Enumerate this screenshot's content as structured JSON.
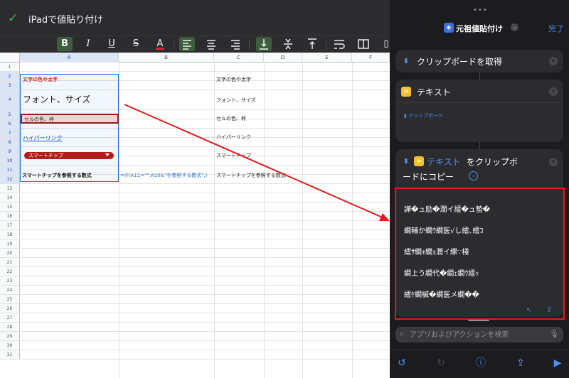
{
  "topbar": {
    "check_icon": "check-icon",
    "title": "iPadで値貼り付け"
  },
  "toolbar": {
    "bold": "B",
    "italic": "I",
    "underline": "U",
    "strike": "S",
    "textcolor": "A",
    "text_color_bar": "#d62b2b",
    "active_bg": "#3d5e3e"
  },
  "sheet": {
    "columns": [
      "A",
      "B",
      "C",
      "D",
      "E",
      "F"
    ],
    "rows": [
      "1",
      "2",
      "3",
      "4",
      "5",
      "6",
      "7",
      "8",
      "9",
      "10",
      "11",
      "12",
      "13",
      "14",
      "15",
      "16",
      "17",
      "18",
      "19",
      "20",
      "21",
      "22",
      "23",
      "24",
      "25",
      "26",
      "27",
      "28",
      "29",
      "30",
      "31"
    ],
    "a2": "文字の色や太字",
    "a4": "フォント、サイズ",
    "a6": "セルの色、枠",
    "a8": "ハイパーリンク",
    "a10": "スマートチップ",
    "a12": "スマートチップを参照する数式",
    "b12": "=IF(A11=\"\",A10&\"を参照する数式\",)",
    "c2": "文字の色や太字",
    "c4": "フォント、サイズ",
    "c6": "セルの色、枠",
    "c8": "ハイパーリンク",
    "c10": "スマートチップ",
    "c12": "スマートチップを参照する数式",
    "colors": {
      "red_text": "#c62828",
      "link": "#1a56c4",
      "selection": "#1a73e8",
      "cell_fill": "#f3d4cd",
      "cell_border": "#8f1d1d",
      "chip": "#b11c1c"
    }
  },
  "panel": {
    "grabber": "•••",
    "title": "元祖値貼付け",
    "done": "完了",
    "cards": {
      "get_clipboard": "クリップボードを取得",
      "text": "テキスト",
      "text_var": "クリップボード",
      "copy_prefix": "テキスト",
      "copy_line1_suffix": " をクリップボ",
      "copy_line2": "ードにコピー"
    },
    "output_lines": [
      "譁�ュ励�濶イ繧�ュ蟄�",
      "繝輔か繝ｳ繝医√し繧､繧ｺ",
      "繧ｻ繝ｫ繝ｮ濶イ縲∵棧",
      "繝上う繝代�繝ｪ繝ｳ繧ｯ",
      "繧ｹ繝槭�繝医メ繝��"
    ],
    "search": {
      "placeholder": "アプリおよびアクションを検索"
    },
    "accent": "#4a90ff",
    "highlight": "#e01c1c"
  }
}
